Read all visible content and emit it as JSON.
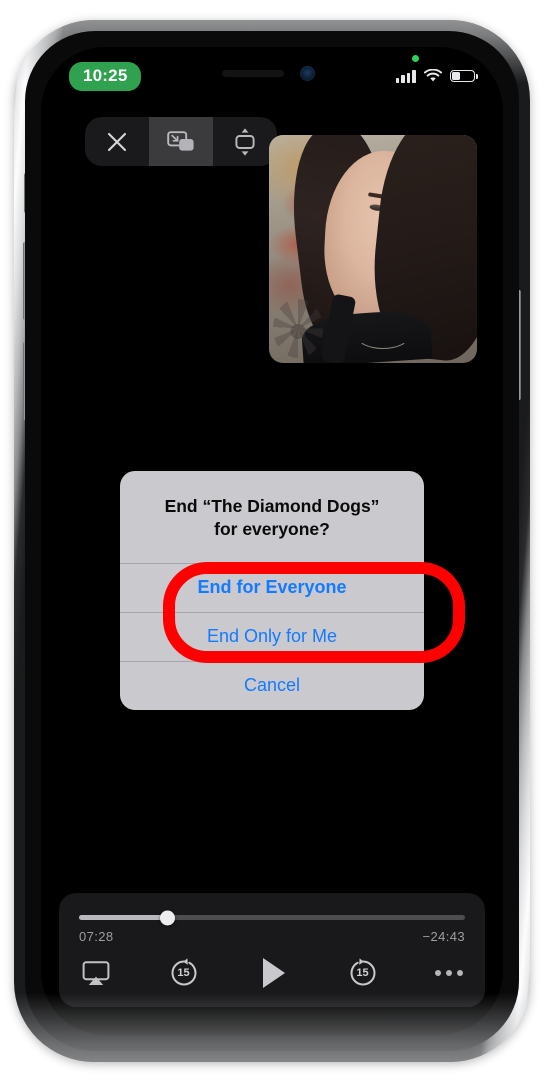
{
  "device": {
    "type": "iphone-mockup",
    "frame_color": "#c9cbcd"
  },
  "status_bar": {
    "time": "10:25",
    "time_pill_color": "#30a14e",
    "privacy_indicator": "green-dot",
    "cellular_bars": 4,
    "wifi": "connected",
    "battery_percent": 38
  },
  "control_bar": {
    "buttons": [
      {
        "name": "close-icon",
        "label": "Close",
        "active": false
      },
      {
        "name": "picture-in-picture-icon",
        "label": "Picture in Picture",
        "active": true
      },
      {
        "name": "resize-screen-icon",
        "label": "Resize Screen",
        "active": false
      }
    ]
  },
  "self_view": {
    "label": "Camera self view",
    "visible": true
  },
  "alert": {
    "title": "End “The Diamond Dogs”\nfor everyone?",
    "title_line1": "End “The Diamond Dogs”",
    "title_line2": "for everyone?",
    "background": "#c9c9ce",
    "accent": "#147aff",
    "actions": [
      {
        "label": "End for Everyone",
        "style": "bold",
        "highlighted": true
      },
      {
        "label": "End Only for Me",
        "style": "regular",
        "highlighted": true
      },
      {
        "label": "Cancel",
        "style": "regular",
        "highlighted": false
      }
    ]
  },
  "annotation": {
    "shape": "rounded-rectangle",
    "color": "#fe0000",
    "targets": [
      "End for Everyone",
      "End Only for Me"
    ]
  },
  "player": {
    "elapsed": "07:28",
    "remaining": "−24:43",
    "progress_percent": 23,
    "state": "paused",
    "controls": [
      {
        "name": "airplay-icon",
        "label": "AirPlay"
      },
      {
        "name": "skip-back-icon",
        "label": "Skip back",
        "seconds": "15"
      },
      {
        "name": "play-icon",
        "label": "Play"
      },
      {
        "name": "skip-forward-icon",
        "label": "Skip forward",
        "seconds": "15"
      },
      {
        "name": "more-options-icon",
        "label": "More"
      }
    ]
  }
}
